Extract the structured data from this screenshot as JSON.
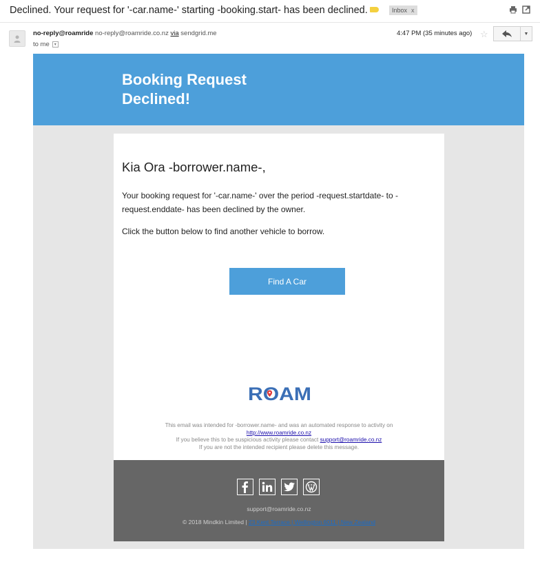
{
  "subject": {
    "text": "Declined. Your request for '-car.name-' starting -booking.start- has been declined.",
    "label_color": "#f4d03f",
    "inbox_chip": "Inbox",
    "inbox_chip_close": "x"
  },
  "toolbar_icons": [
    "print-icon",
    "open-new-window-icon"
  ],
  "header": {
    "sender_name": "no-reply@roamride",
    "sender_email": "no-reply@roamride.co.nz",
    "via_label": "via",
    "via_domain": "sendgrid.me",
    "to": "to me",
    "time": "4:47 PM (35 minutes ago)"
  },
  "email": {
    "hero_title": "Booking Request\nDeclined!",
    "greeting": "Kia Ora -borrower.name-,",
    "paragraph1": "Your booking request for '-car.name-' over the period -request.startdate- to -request.enddate- has been declined by the owner.",
    "paragraph2": "Click the button below to find another vehicle to borrow.",
    "cta_label": "Find A Car",
    "logo_text": "ROAM",
    "fine_print": {
      "line1": "This email was intended for -borrower.name- and was an automated response to activity on",
      "link1": "http://www.roamride.co.nz",
      "line3_prefix": "If you believe this to be suspicious activity please contact",
      "link2": "support@roamride.co.nz",
      "line4": "If you are not the intended recipient please delete this message."
    },
    "footer": {
      "social": [
        "facebook-icon",
        "linkedin-icon",
        "twitter-icon",
        "wordpress-icon"
      ],
      "email": "support@roamride.co.nz",
      "copyright": "© 2018 Mindkin Limited |",
      "address_link": "23 Kent Terrace | Wellington 6011 | New Zealand"
    },
    "colors": {
      "brand_blue": "#4d9fda",
      "footer_gray": "#666666",
      "logo_blue": "#3b6fb6",
      "logo_red": "#e03a3a"
    }
  }
}
